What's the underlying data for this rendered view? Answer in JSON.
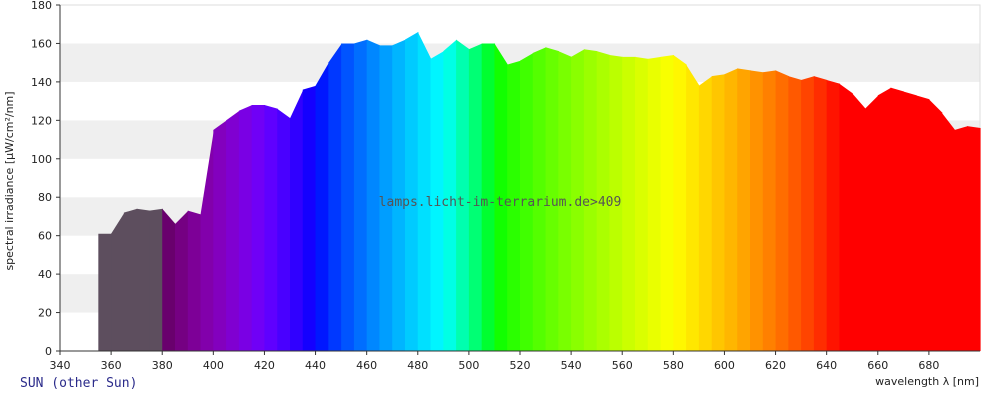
{
  "caption": "SUN (other Sun)",
  "watermark": "lamps.licht-im-terrarium.de>409",
  "chart_data": {
    "type": "area",
    "xlabel": "wavelength λ [nm]",
    "ylabel": "spectral irradiance [µW/cm²/nm]",
    "xlim": [
      340,
      700
    ],
    "ylim": [
      0,
      180
    ],
    "x_ticks": [
      340,
      360,
      380,
      400,
      420,
      440,
      460,
      480,
      500,
      520,
      540,
      560,
      580,
      600,
      620,
      640,
      660,
      680
    ],
    "y_ticks": [
      0,
      20,
      40,
      60,
      80,
      100,
      120,
      140,
      160,
      180
    ],
    "grid": "alternating horizontal bands",
    "fill": "wavelength colored spectrum; UV region grey",
    "x": [
      355,
      360,
      365,
      370,
      375,
      380,
      385,
      390,
      395,
      400,
      405,
      410,
      415,
      420,
      425,
      430,
      435,
      440,
      445,
      450,
      455,
      460,
      465,
      470,
      475,
      480,
      485,
      490,
      495,
      500,
      505,
      510,
      515,
      520,
      525,
      530,
      535,
      540,
      545,
      550,
      555,
      560,
      565,
      570,
      575,
      580,
      585,
      590,
      595,
      600,
      605,
      610,
      615,
      620,
      625,
      630,
      635,
      640,
      645,
      650,
      655,
      660,
      665,
      670,
      675,
      680,
      685,
      690,
      695,
      700
    ],
    "y": [
      61,
      61,
      72,
      74,
      73,
      74,
      66,
      73,
      71,
      115,
      120,
      125,
      128,
      128,
      126,
      121,
      136,
      138,
      150,
      160,
      160,
      162,
      159,
      159,
      162,
      166,
      152,
      156,
      162,
      157,
      160,
      160,
      149,
      151,
      155,
      158,
      156,
      153,
      157,
      156,
      154,
      153,
      153,
      152,
      153,
      154,
      149,
      138,
      143,
      144,
      147,
      146,
      145,
      146,
      143,
      141,
      143,
      141,
      139,
      134,
      126,
      133,
      137,
      135,
      133,
      131,
      124,
      115,
      117,
      116
    ]
  }
}
